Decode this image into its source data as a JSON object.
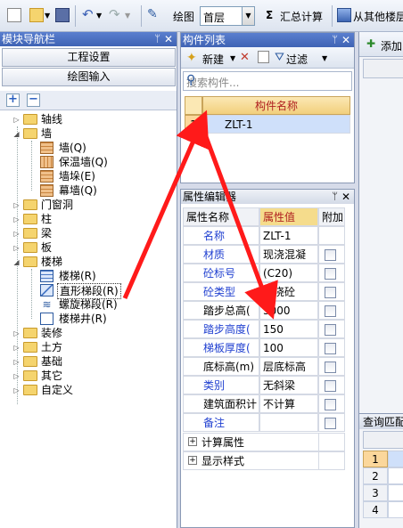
{
  "toolbar": {
    "view_label": "绘图",
    "floor_value": "首层",
    "sum_label": "汇总计算",
    "copy_label": "从其他楼层"
  },
  "nav_panel": {
    "title": "模块导航栏",
    "project_settings": "工程设置",
    "drawing_input": "绘图输入"
  },
  "tree": {
    "axis": "轴线",
    "wall": "墙",
    "wall_items": [
      "墙(Q)",
      "保温墙(Q)",
      "墙垛(E)",
      "幕墙(Q)"
    ],
    "door_window": "门窗洞",
    "column": "柱",
    "beam": "梁",
    "slab": "板",
    "stairs": "楼梯",
    "stairs_items": [
      "楼梯(R)",
      "直形梯段(R)",
      "螺旋梯段(R)",
      "楼梯井(R)"
    ],
    "decor": "装修",
    "earthwork": "土方",
    "foundation": "基础",
    "other": "其它",
    "custom": "自定义"
  },
  "component_list": {
    "title": "构件列表",
    "new_label": "新建",
    "filter_label": "过滤",
    "search_placeholder": "搜索构件...",
    "col_name": "构件名称",
    "rows": [
      {
        "num": "1",
        "name": "ZLT-1"
      }
    ]
  },
  "properties": {
    "title": "属性编辑器",
    "col_name": "属性名称",
    "col_value": "属性值",
    "col_extra": "附加",
    "rows": [
      {
        "name": "名称",
        "value": "ZLT-1",
        "blue": true,
        "check": false
      },
      {
        "name": "材质",
        "value": "现浇混凝",
        "blue": true,
        "check": true
      },
      {
        "name": "砼标号",
        "value": "(C20)",
        "blue": true,
        "check": true
      },
      {
        "name": "砼类型",
        "value": "现浇砼",
        "blue": true,
        "check": true
      },
      {
        "name": "踏步总高(",
        "value": "3000",
        "blue": false,
        "check": true
      },
      {
        "name": "踏步高度(",
        "value": "150",
        "blue": true,
        "check": true
      },
      {
        "name": "梯板厚度(",
        "value": "100",
        "blue": true,
        "check": true
      },
      {
        "name": "底标高(m)",
        "value": "层底标高",
        "blue": false,
        "check": true
      },
      {
        "name": "类别",
        "value": "无斜梁",
        "blue": true,
        "check": true
      },
      {
        "name": "建筑面积计",
        "value": "不计算",
        "blue": false,
        "check": true
      },
      {
        "name": "备注",
        "value": "",
        "blue": true,
        "check": true
      }
    ],
    "group1": "计算属性",
    "group2": "显示样式"
  },
  "right_panel": {
    "add_label": "添加",
    "query_title": "查询匹配",
    "row_nums": [
      "1",
      "2",
      "3",
      "4"
    ]
  },
  "colors": {
    "title_bar": "#3f63b4",
    "annotation_arrow": "#ff1a1a",
    "selected_row": "#cfe0fa",
    "header_orange": "#f2cf7b"
  }
}
